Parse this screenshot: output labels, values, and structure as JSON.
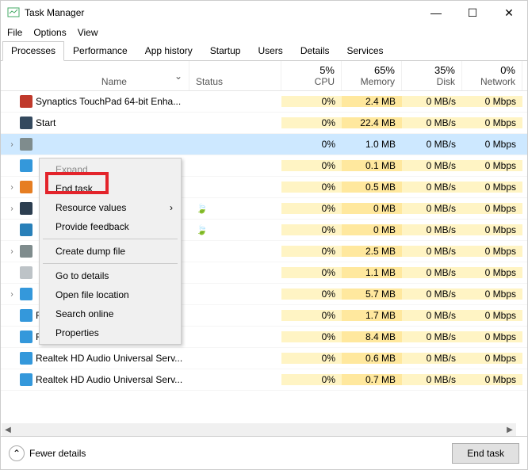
{
  "window": {
    "title": "Task Manager"
  },
  "menu": {
    "file": "File",
    "options": "Options",
    "view": "View"
  },
  "tabs": {
    "processes": "Processes",
    "performance": "Performance",
    "apphistory": "App history",
    "startup": "Startup",
    "users": "Users",
    "details": "Details",
    "services": "Services"
  },
  "columns": {
    "name": "Name",
    "status": "Status",
    "cpu_pct": "5%",
    "cpu": "CPU",
    "mem_pct": "65%",
    "mem": "Memory",
    "disk_pct": "35%",
    "disk": "Disk",
    "net_pct": "0%",
    "net": "Network"
  },
  "processes": [
    {
      "icon": "#c0392b",
      "name": "Synaptics TouchPad 64-bit Enha...",
      "expand": "",
      "cpu": "0%",
      "mem": "2.4 MB",
      "disk": "0 MB/s",
      "net": "0 Mbps",
      "leaf": false
    },
    {
      "icon": "#34495e",
      "name": "Start",
      "expand": "",
      "cpu": "0%",
      "mem": "22.4 MB",
      "disk": "0 MB/s",
      "net": "0 Mbps",
      "leaf": false
    },
    {
      "icon": "#7f8c8d",
      "name": "",
      "expand": ">",
      "cpu": "0%",
      "mem": "1.0 MB",
      "disk": "0 MB/s",
      "net": "0 Mbps",
      "selected": true,
      "leaf": false
    },
    {
      "icon": "#3498db",
      "name": "",
      "expand": "",
      "cpu": "0%",
      "mem": "0.1 MB",
      "disk": "0 MB/s",
      "net": "0 Mbps",
      "leaf": false
    },
    {
      "icon": "#e67e22",
      "name": "",
      "expand": ">",
      "cpu": "0%",
      "mem": "0.5 MB",
      "disk": "0 MB/s",
      "net": "0 Mbps",
      "leaf": false
    },
    {
      "icon": "#2c3e50",
      "name": "",
      "expand": ">",
      "cpu": "0%",
      "mem": "0 MB",
      "disk": "0 MB/s",
      "net": "0 Mbps",
      "leaf": true
    },
    {
      "icon": "#2980b9",
      "name": "",
      "expand": "",
      "cpu": "0%",
      "mem": "0 MB",
      "disk": "0 MB/s",
      "net": "0 Mbps",
      "leaf": true
    },
    {
      "icon": "#7f8c8d",
      "name": "",
      "expand": ">",
      "cpu": "0%",
      "mem": "2.5 MB",
      "disk": "0 MB/s",
      "net": "0 Mbps",
      "leaf": false
    },
    {
      "icon": "#bdc3c7",
      "name": "",
      "expand": "",
      "cpu": "0%",
      "mem": "1.1 MB",
      "disk": "0 MB/s",
      "net": "0 Mbps",
      "leaf": false
    },
    {
      "icon": "#3498db",
      "name": "",
      "expand": ">",
      "cpu": "0%",
      "mem": "5.7 MB",
      "disk": "0 MB/s",
      "net": "0 Mbps",
      "leaf": false
    },
    {
      "icon": "#3498db",
      "name": "Runtime Broker",
      "expand": "",
      "cpu": "0%",
      "mem": "1.7 MB",
      "disk": "0 MB/s",
      "net": "0 Mbps",
      "leaf": false
    },
    {
      "icon": "#3498db",
      "name": "Runtime Broker",
      "expand": "",
      "cpu": "0%",
      "mem": "8.4 MB",
      "disk": "0 MB/s",
      "net": "0 Mbps",
      "leaf": false
    },
    {
      "icon": "#3498db",
      "name": "Realtek HD Audio Universal Serv...",
      "expand": "",
      "cpu": "0%",
      "mem": "0.6 MB",
      "disk": "0 MB/s",
      "net": "0 Mbps",
      "leaf": false
    },
    {
      "icon": "#3498db",
      "name": "Realtek HD Audio Universal Serv...",
      "expand": "",
      "cpu": "0%",
      "mem": "0.7 MB",
      "disk": "0 MB/s",
      "net": "0 Mbps",
      "leaf": false
    }
  ],
  "context_menu": {
    "expand": "Expand",
    "endtask": "End task",
    "resource": "Resource values",
    "feedback": "Provide feedback",
    "dumpfile": "Create dump file",
    "details": "Go to details",
    "openloc": "Open file location",
    "search": "Search online",
    "properties": "Properties"
  },
  "footer": {
    "fewer": "Fewer details",
    "endtask": "End task"
  }
}
